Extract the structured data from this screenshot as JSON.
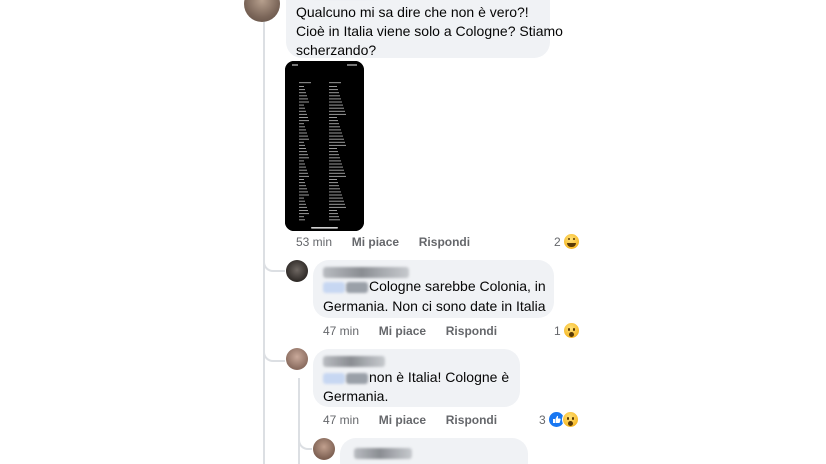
{
  "post_comment": {
    "author_name_redacted": true,
    "text_lines": [
      "Qualcuno mi sa dire che non è vero?!",
      "Cioè in Italia viene solo a Cologne? Stiamo",
      "scherzando?"
    ],
    "attachment": {
      "kind": "phone-screenshot",
      "description_icon": "screenshot-icon"
    },
    "time": "53 min",
    "like_label": "Mi piace",
    "reply_label": "Rispondi",
    "reaction_count": "2",
    "reaction_icon": "haha-icon"
  },
  "replies": [
    {
      "author_name_redacted": true,
      "text_lines": [
        "Cologne sarebbe Colonia, in",
        "Germania. Non ci sono date in Italia"
      ],
      "time": "47 min",
      "like_label": "Mi piace",
      "reply_label": "Rispondi",
      "reaction_count": "1",
      "reaction_icon": "wow-icon"
    },
    {
      "author_name_redacted": true,
      "text_lines": [
        "non è Italia! Cologne è",
        "Germania."
      ],
      "time": "47 min",
      "like_label": "Mi piace",
      "reply_label": "Rispondi",
      "reaction_count": "3",
      "reaction_icons": [
        "like-icon",
        "wow-icon"
      ]
    },
    {
      "author_name_redacted": true,
      "text_lines": []
    }
  ],
  "colors": {
    "bubble": "#f0f2f5",
    "meta_text": "#65676b",
    "thread_line": "#dcdfe3",
    "like_blue": "#1877f2",
    "reaction_yellow": "#f7b928"
  }
}
